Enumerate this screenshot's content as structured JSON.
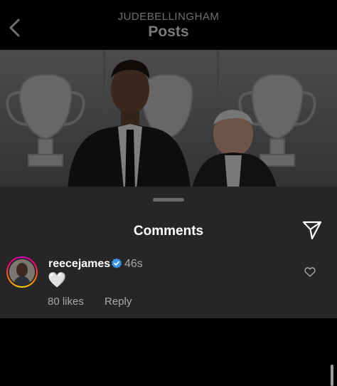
{
  "header": {
    "account": "JUDEBELLINGHAM",
    "title": "Posts"
  },
  "post": {
    "image": "photo of two men in suits in front of trophy cabinet"
  },
  "comments_sheet": {
    "title": "Comments",
    "comment": {
      "username": "reecejames",
      "time": "46s",
      "text": "🤍",
      "likes": "80 likes",
      "reply": "Reply"
    }
  },
  "icons": {
    "back": "chevron-left-icon",
    "send": "paper-plane-icon",
    "verified": "verified-badge-icon",
    "like": "heart-outline-icon"
  },
  "colors": {
    "sheet_background": "#262626",
    "verified_blue": "#3897f0",
    "muted_text": "#a8a8a8"
  }
}
